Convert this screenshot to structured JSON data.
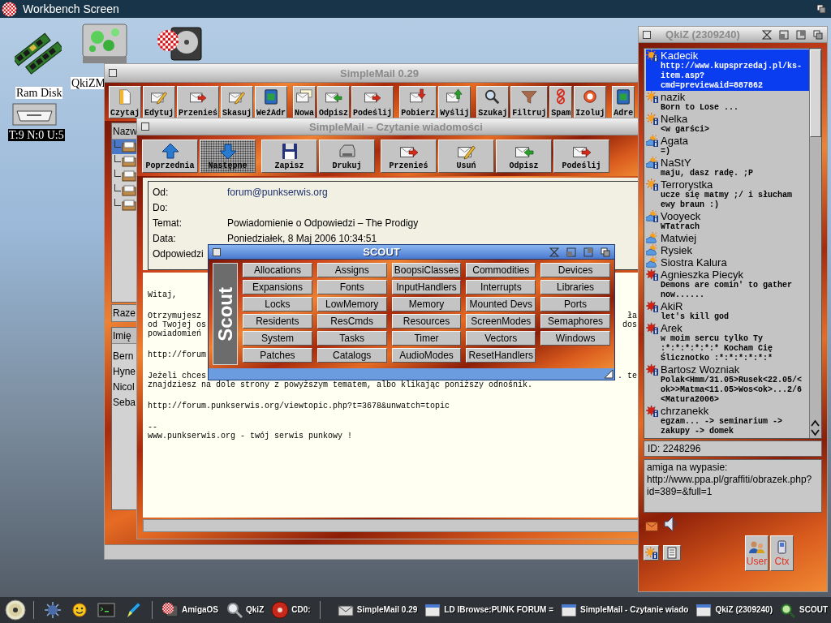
{
  "screen_bar": {
    "title": "Workbench Screen"
  },
  "desktop_icons": [
    {
      "kind": "ram",
      "label": "Ram Disk",
      "selected": false
    },
    {
      "kind": "drive",
      "label": "QkiZM",
      "selected": false
    },
    {
      "kind": "harddisk"
    },
    {
      "kind": "tray",
      "label": "T:9 N:0 U:5",
      "selected": true
    }
  ],
  "mail_window": {
    "title": "SimpleMail 0.29",
    "active": false,
    "toolbar": [
      [
        {
          "label": "Czytaj"
        },
        {
          "label": "Edytuj"
        },
        {
          "label": "Przenieś"
        },
        {
          "label": "Skasuj"
        },
        {
          "label": "WeźAdr"
        }
      ],
      [
        {
          "label": "Nowa"
        },
        {
          "label": "Odpisz"
        },
        {
          "label": "Podeślij"
        }
      ],
      [
        {
          "label": "Pobierz"
        },
        {
          "label": "Wyślij"
        }
      ],
      [
        {
          "label": "Szukaj"
        },
        {
          "label": "Filtruj"
        },
        {
          "label": "Spam"
        },
        {
          "label": "Izoluj"
        }
      ],
      [
        {
          "label": "Adre"
        }
      ]
    ],
    "folder_list": {
      "header": "Nazw",
      "folders": [
        {
          "selected": true
        },
        {
          "selected": false
        },
        {
          "selected": false
        },
        {
          "selected": false
        },
        {
          "selected": false
        }
      ]
    },
    "total_label": "Raze",
    "address_list": {
      "header": "Imię",
      "names": [
        "Bern",
        "Hyne",
        "Nicol",
        "Seba"
      ]
    }
  },
  "reader_window": {
    "title": "SimpleMail – Czytanie wiadomości",
    "active": false,
    "toolbar": [
      [
        {
          "label": "Poprzednia",
          "disabled": false
        },
        {
          "label": "Następne",
          "disabled": true
        }
      ],
      [
        {
          "label": "Zapisz",
          "disabled": false
        },
        {
          "label": "Drukuj",
          "disabled": false
        }
      ],
      [
        {
          "label": "Przenieś",
          "disabled": false
        },
        {
          "label": "Usuń",
          "disabled": false
        },
        {
          "label": "Odpisz",
          "disabled": false
        },
        {
          "label": "Podeślij",
          "disabled": false
        }
      ]
    ],
    "headers": [
      {
        "label": "Od:",
        "value": "forum@punkserwis.org",
        "kind": "link"
      },
      {
        "label": "Do:"
      },
      {
        "label": "Temat:",
        "value": "Powiadomienie o Odpowiedzi – The Prodigy",
        "kind": "text"
      },
      {
        "label": "Data:",
        "value": "Poniedziałek, 8 Maj 2006 10:34:51",
        "kind": "text"
      },
      {
        "label": "Odpowiedzi"
      }
    ],
    "body": [
      [
        {
          "text": "Witaj,"
        }
      ],
      [
        {
          "text": "Otrzymujesz",
          "tail": "ła"
        },
        {
          "text": "od Twojej os",
          "tail": "dos"
        },
        {
          "text": "powiadomień"
        }
      ],
      [
        {
          "text": "http://forum"
        }
      ],
      [
        {
          "text": "Jeżeli chces",
          "tail": ". te"
        },
        {
          "text": "znajdziesz na dole strony z powyższym tematem, albo klikając poniższy odnośnik."
        }
      ],
      [
        {
          "text": "http://forum.punkserwis.org/viewtopic.php?t=3678&unwatch=topic"
        }
      ],
      [
        {
          "text": "--"
        },
        {
          "text": "www.punkserwis.org - twój serwis punkowy !"
        }
      ]
    ]
  },
  "scout_window": {
    "title": "SCOUT",
    "active": true,
    "logo": "Scout",
    "buttons": [
      "Allocations",
      "Assigns",
      "BoopsiClasses",
      "Commodities",
      "Devices",
      "Expansions",
      "Fonts",
      "InputHandlers",
      "Interrupts",
      "Libraries",
      "Locks",
      "LowMemory",
      "Memory",
      "Mounted Devs",
      "Ports",
      "Residents",
      "ResCmds",
      "Resources",
      "ScreenModes",
      "Semaphores",
      "System",
      "Tasks",
      "Timer",
      "Vectors",
      "Windows",
      "Patches",
      "Catalogs",
      "AudioModes",
      "ResetHandlers"
    ]
  },
  "qkiz_window": {
    "title": "QkiZ (2309240)",
    "active": false,
    "contacts": [
      {
        "name": "Kadecik",
        "kind": "available",
        "description": "http://www.kupsprzedaj.pl/ks-item.asp?cmd=preview&id=887862",
        "selected": true
      },
      {
        "name": "nazik",
        "kind": "available",
        "description": "Born to Lose ...",
        "selected": false
      },
      {
        "name": "Nelka",
        "kind": "available",
        "description": "<w garści>",
        "selected": false
      },
      {
        "name": "Agata",
        "kind": "away",
        "description": "=)",
        "selected": false
      },
      {
        "name": "NaStY",
        "kind": "away",
        "description": "maju, dasz radę. ;P",
        "selected": false
      },
      {
        "name": "Terrorystka",
        "kind": "available",
        "description": "ucze się matmy ;/ i słucham ewy braun :)",
        "selected": false
      },
      {
        "name": "Vooyeck",
        "kind": "away",
        "description": "WTatrach",
        "selected": false
      },
      {
        "name": "Matwiej",
        "kind": "away",
        "selected": false
      },
      {
        "name": "Rysiek",
        "kind": "away",
        "selected": false
      },
      {
        "name": "Siostra Kalura",
        "kind": "away",
        "selected": false
      },
      {
        "name": "Agnieszka Piecyk",
        "kind": "offline",
        "description": "Demons are comin' to gather now......",
        "selected": false
      },
      {
        "name": "AkiR",
        "kind": "offline",
        "description": "let's kill god",
        "selected": false
      },
      {
        "name": "Arek",
        "kind": "offline",
        "description": "w moim sercu tylko Ty :*:*:*:*:*:* Kocham Cię Ślicznotko :*:*:*:*:*:*",
        "selected": false
      },
      {
        "name": "Bartosz Wozniak",
        "kind": "offline",
        "description": "Polak<Hmm/31.05>Rusek<22.05/<ok>>Matma<11.05>Wos<ok>...2/6<Matura2006>",
        "selected": false
      },
      {
        "name": "chrzanekk",
        "kind": "offline",
        "description": "egzam... -> seminarium -> zakupy -> domek",
        "selected": false
      }
    ],
    "id_field": "ID: 2248296",
    "message": "amiga na wypasie: http://www.ppa.pl/graffiti/obrazek.php?id=389=&full=1",
    "buttons": [
      {
        "label": "User",
        "kind": "user"
      },
      {
        "label": "Ctx",
        "kind": "contacts"
      }
    ]
  },
  "taskbar": {
    "drives": [
      {
        "label": "AmigaOS",
        "kind": "harddisk"
      },
      {
        "label": "QkiZ",
        "kind": "magnifier"
      },
      {
        "label": "CD0:",
        "kind": "cd"
      }
    ],
    "tasks": [
      {
        "label": "SimpleMail 0.29",
        "kind": "mail"
      },
      {
        "label": "LD IBrowse:PUNK FORUM =",
        "kind": "window"
      },
      {
        "label": "SimpleMail - Czytanie wiado",
        "kind": "window"
      },
      {
        "label": "QkiZ (2309240)",
        "kind": "window"
      },
      {
        "label": "SCOUT",
        "kind": "scout"
      }
    ]
  }
}
